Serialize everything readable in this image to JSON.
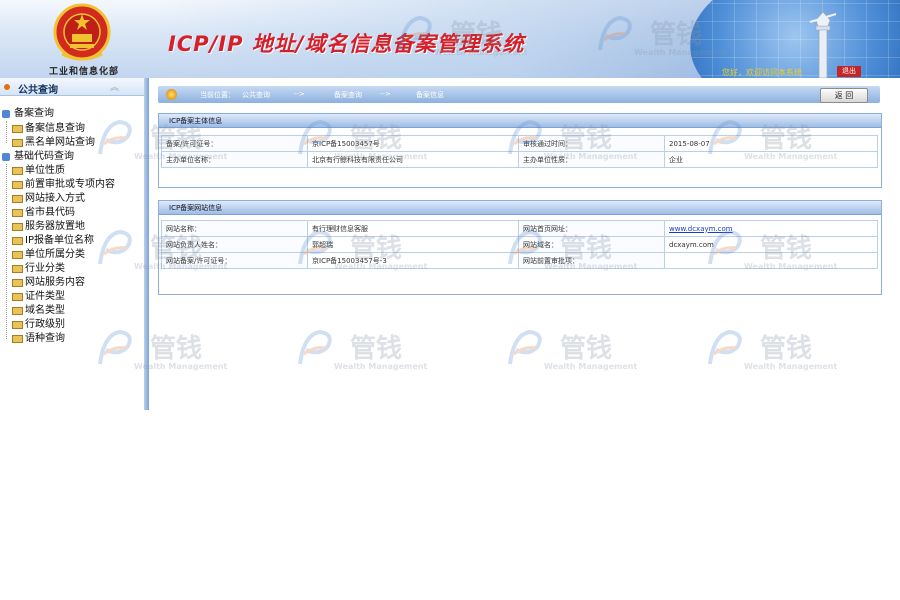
{
  "header": {
    "ministry": "工业和信息化部",
    "system_title": "ICP/IP 地址/域名信息备案管理系统",
    "welcome": "您好，欢迎访问本系统",
    "logout": "退出"
  },
  "sidebar": {
    "title": "公共查询",
    "groups": [
      {
        "label": "备案查询",
        "items": [
          "备案信息查询",
          "黑名单网站查询"
        ]
      },
      {
        "label": "基础代码查询",
        "items": [
          "单位性质",
          "前置审批或专项内容",
          "网站接入方式",
          "省市县代码",
          "服务器放置地",
          "IP报备单位名称",
          "单位所属分类",
          "行业分类",
          "网站服务内容",
          "证件类型",
          "域名类型",
          "行政级别",
          "语种查询"
        ]
      }
    ]
  },
  "breadcrumb": {
    "prefix": "当前位置：",
    "items": [
      "公共查询",
      "备案查询",
      "备案信息"
    ],
    "separator": "-->",
    "back": "返 回"
  },
  "panel1": {
    "title": "ICP备案主体信息",
    "rows": [
      {
        "k1": "备案/许可证号：",
        "v1": "京ICP备15003457号",
        "k2": "审核通过时间：",
        "v2": "2015-08-07"
      },
      {
        "k1": "主办单位名称：",
        "v1": "北京有行鲸科技有限责任公司",
        "k2": "主办单位性质：",
        "v2": "企业"
      }
    ]
  },
  "panel2": {
    "title": "ICP备案网站信息",
    "rows": [
      {
        "k1": "网站名称：",
        "v1": "有行理财信息客服",
        "k2": "网站首页网址：",
        "v2": "www.dcxaym.com"
      },
      {
        "k1": "网站负责人姓名：",
        "v1": "郭超瑞",
        "k2": "网站域名：",
        "v2": "dcxaym.com"
      },
      {
        "k1": "网站备案/许可证号：",
        "v1": "京ICP备15003457号-3",
        "k2": "网站前置审批项：",
        "v2": ""
      }
    ]
  },
  "watermark": {
    "cn": "管钱",
    "en": "Wealth Management"
  },
  "colors": {
    "title_red": "#d3202a",
    "nav_blue": "#8db0df",
    "link_blue": "#1a3cc9"
  }
}
